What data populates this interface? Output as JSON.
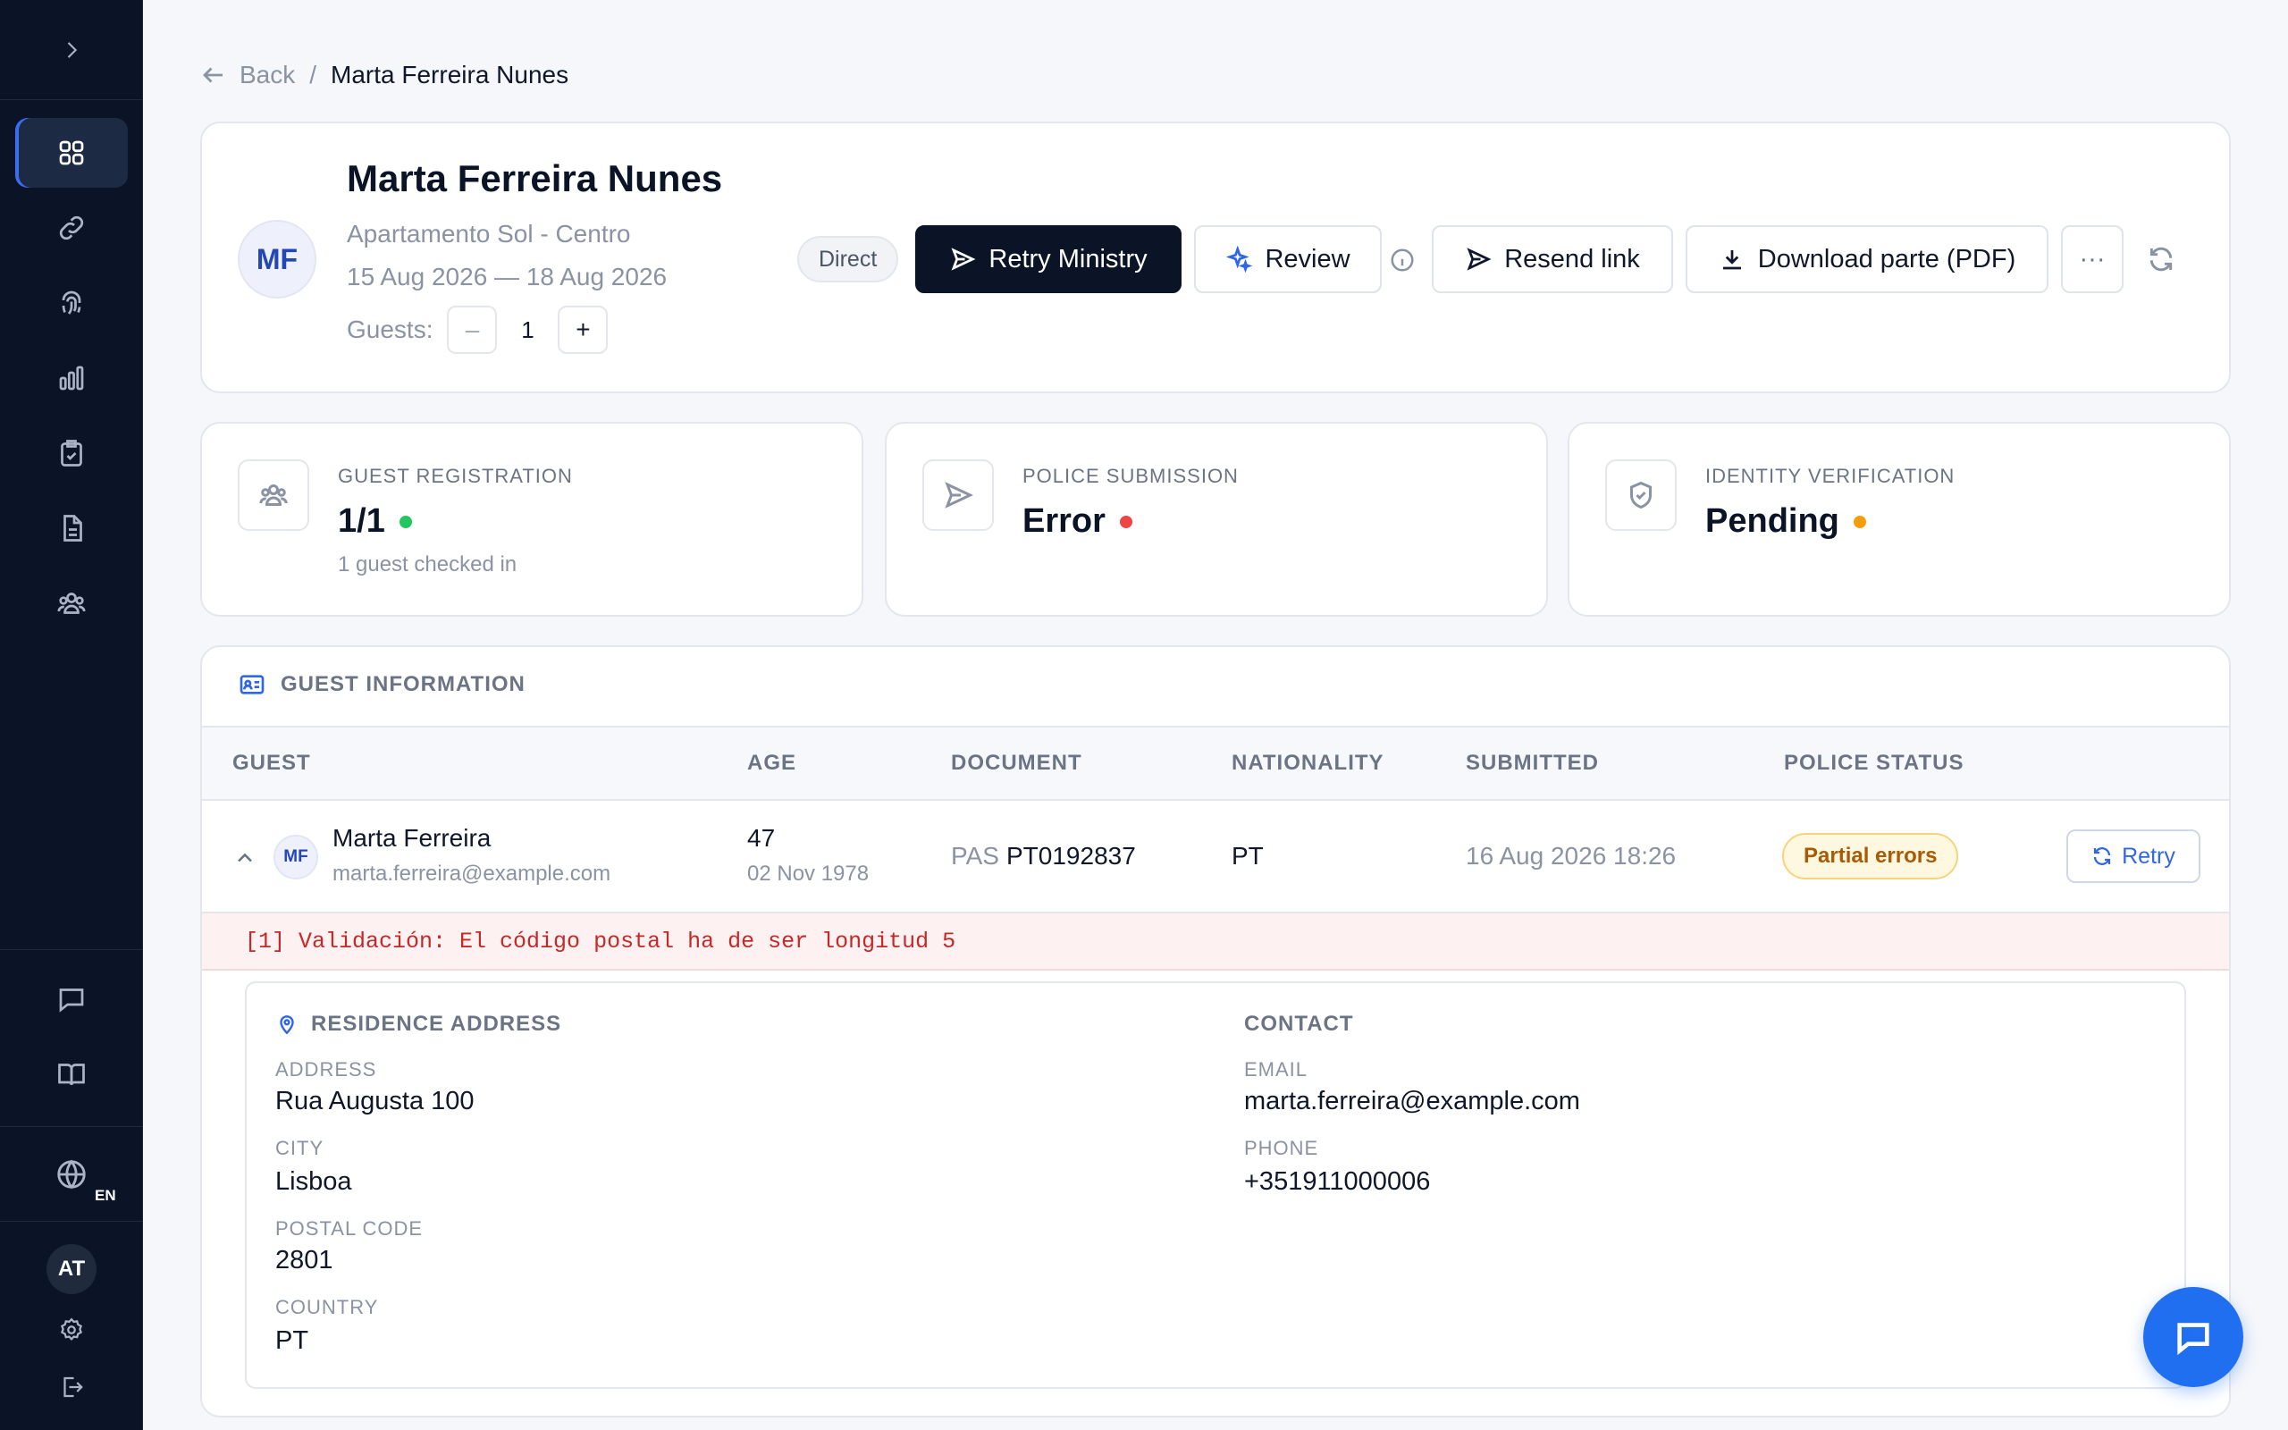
{
  "breadcrumb": {
    "back": "Back",
    "separator": "/",
    "current": "Marta Ferreira Nunes"
  },
  "header": {
    "initials": "MF",
    "name": "Marta Ferreira Nunes",
    "property": "Apartamento Sol - Centro",
    "dates": "15 Aug 2026 — 18 Aug 2026",
    "guests_label": "Guests:",
    "guests_minus": "–",
    "guests_value": "1",
    "guests_plus": "+",
    "channel": "Direct",
    "retry_ministry": "Retry Ministry",
    "review": "Review",
    "resend_link": "Resend link",
    "download": "Download parte (PDF)",
    "more": "···"
  },
  "status": {
    "registration": {
      "label": "GUEST REGISTRATION",
      "value": "1/1",
      "sub": "1 guest checked in",
      "color": "#22c55e"
    },
    "police": {
      "label": "POLICE SUBMISSION",
      "value": "Error",
      "color": "#ef4444"
    },
    "identity": {
      "label": "IDENTITY VERIFICATION",
      "value": "Pending",
      "color": "#f59e0b"
    }
  },
  "guest_info": {
    "title": "GUEST INFORMATION",
    "columns": {
      "guest": "GUEST",
      "age": "AGE",
      "document": "DOCUMENT",
      "nationality": "NATIONALITY",
      "submitted": "SUBMITTED",
      "police_status": "POLICE STATUS"
    },
    "row": {
      "initials": "MF",
      "name": "Marta Ferreira",
      "email": "marta.ferreira@example.com",
      "age": "47",
      "dob": "02 Nov 1978",
      "doc_type": "PAS",
      "doc_number": "PT0192837",
      "nationality": "PT",
      "submitted": "16 Aug 2026 18:26",
      "police_status": "Partial errors",
      "retry": "Retry"
    },
    "error": "[1] Validación: El código postal ha de ser longitud 5",
    "residence": {
      "title": "RESIDENCE ADDRESS",
      "address_label": "ADDRESS",
      "address": "Rua Augusta 100",
      "city_label": "CITY",
      "city": "Lisboa",
      "postal_label": "POSTAL CODE",
      "postal": "2801",
      "country_label": "COUNTRY",
      "country": "PT"
    },
    "contact": {
      "title": "CONTACT",
      "email_label": "EMAIL",
      "email": "marta.ferreira@example.com",
      "phone_label": "PHONE",
      "phone": "+351911000006"
    }
  },
  "sidebar": {
    "lang": "EN",
    "user_initials": "AT"
  }
}
